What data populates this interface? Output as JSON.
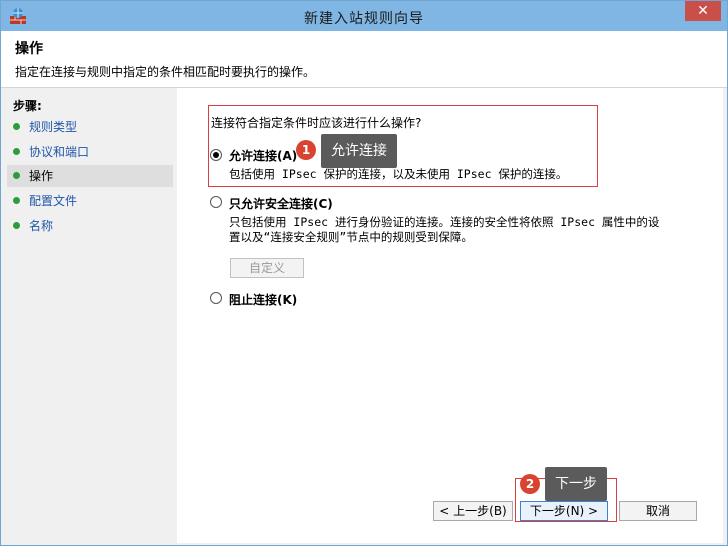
{
  "window": {
    "title": "新建入站规则向导",
    "close_symbol": "✕"
  },
  "header": {
    "title": "操作",
    "description": "指定在连接与规则中指定的条件相匹配时要执行的操作。"
  },
  "sidebar": {
    "title": "步骤:",
    "items": [
      {
        "label": "规则类型"
      },
      {
        "label": "协议和端口"
      },
      {
        "label": "操作"
      },
      {
        "label": "配置文件"
      },
      {
        "label": "名称"
      }
    ]
  },
  "main": {
    "question": "连接符合指定条件时应该进行什么操作?",
    "options": [
      {
        "label": "允许连接(A)",
        "desc": "包括使用 IPsec 保护的连接，以及未使用 IPsec 保护的连接。",
        "selected": true
      },
      {
        "label": "只允许安全连接(C)",
        "desc_line1": "只包括使用 IPsec 进行身份验证的连接。连接的安全性将依照 IPsec 属性中的设",
        "desc_line2": "置以及“连接安全规则”节点中的规则受到保障。",
        "selected": false
      },
      {
        "label": "阻止连接(K)",
        "selected": false
      }
    ],
    "custom_button": "自定义"
  },
  "annotations": {
    "badge1": "1",
    "tooltip1": "允许连接",
    "badge2": "2",
    "tooltip2": "下一步"
  },
  "buttons": {
    "back": "< 上一步(B)",
    "next": "下一步(N) >",
    "cancel": "取消"
  },
  "colors": {
    "accent": "#d8442f",
    "link": "#1f57a8",
    "step_dot": "#2d9c3a",
    "highlight_box": "#d84040"
  },
  "icons": {
    "app": "firewall-rule-icon",
    "close": "close-icon"
  }
}
